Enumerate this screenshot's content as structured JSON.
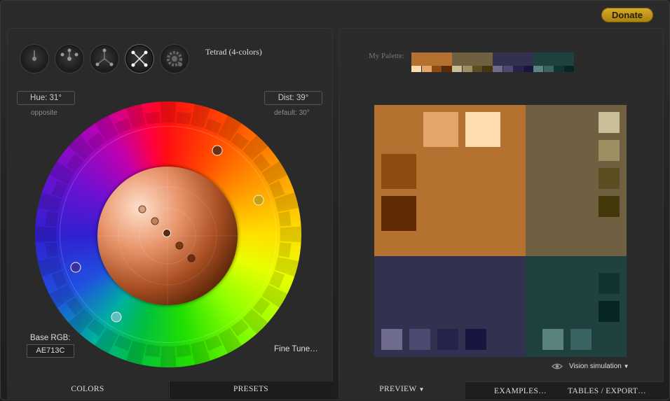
{
  "header": {
    "donate_label": "Donate"
  },
  "scheme": {
    "icons": [
      "mono-scheme-icon",
      "complement-scheme-icon",
      "triad-scheme-icon",
      "tetrad-scheme-icon",
      "analogic-scheme-icon"
    ],
    "active_label": "Tetrad (4-colors)"
  },
  "hue": {
    "label": "Hue: 31°",
    "sub": "opposite"
  },
  "dist": {
    "label": "Dist: 39°",
    "sub": "default: 30°"
  },
  "base": {
    "label": "Base RGB:",
    "value": "AE713C"
  },
  "fine_tune_label": "Fine Tune…",
  "left_tabs": {
    "colors": "COLORS",
    "presets": "PRESETS"
  },
  "right_tabs": {
    "preview": "PREVIEW",
    "examples": "EXAMPLES…",
    "tables": "TABLES / EXPORT…"
  },
  "my_palette_label": "My Palette:",
  "palette": [
    {
      "main": "#b5712f",
      "shades": [
        "#ffdcb0",
        "#e4a56a",
        "#8f4a10",
        "#5f2a04"
      ]
    },
    {
      "main": "#6e6040",
      "shades": [
        "#c8bf98",
        "#9c8f62",
        "#5b4e20",
        "#43380a"
      ]
    },
    {
      "main": "#333150",
      "shades": [
        "#6e6b8e",
        "#4c4a70",
        "#25234a",
        "#181640"
      ]
    },
    {
      "main": "#1f4240",
      "shades": [
        "#5b8480",
        "#3a6462",
        "#0f3432",
        "#072524"
      ]
    }
  ],
  "preview": {
    "quads": [
      "#b5712f",
      "#6e6040",
      "#333150",
      "#1f4240"
    ],
    "swatches": {
      "orange": [
        "#e4a56a",
        "#ffdcb0",
        "#8f4a10",
        "#5f2a04"
      ],
      "olive": [
        "#c8bf98",
        "#9c8f62",
        "#5b4e20",
        "#43380a"
      ],
      "purple": [
        "#6e6b8e",
        "#4c4a70",
        "#25234a",
        "#181640"
      ],
      "teal": [
        "#0f3432",
        "#072524",
        "#5b8480",
        "#3a6462"
      ]
    }
  },
  "vision_label": "Vision simulation",
  "wheel": {
    "handles": [
      {
        "color": "#6a3010",
        "hue_deg": 31
      },
      {
        "color": "#c9a010",
        "hue_deg": 70
      },
      {
        "color": "#3a2fa0",
        "hue_deg": 251
      },
      {
        "color": "#5fc0c0",
        "hue_deg": 211
      }
    ]
  }
}
